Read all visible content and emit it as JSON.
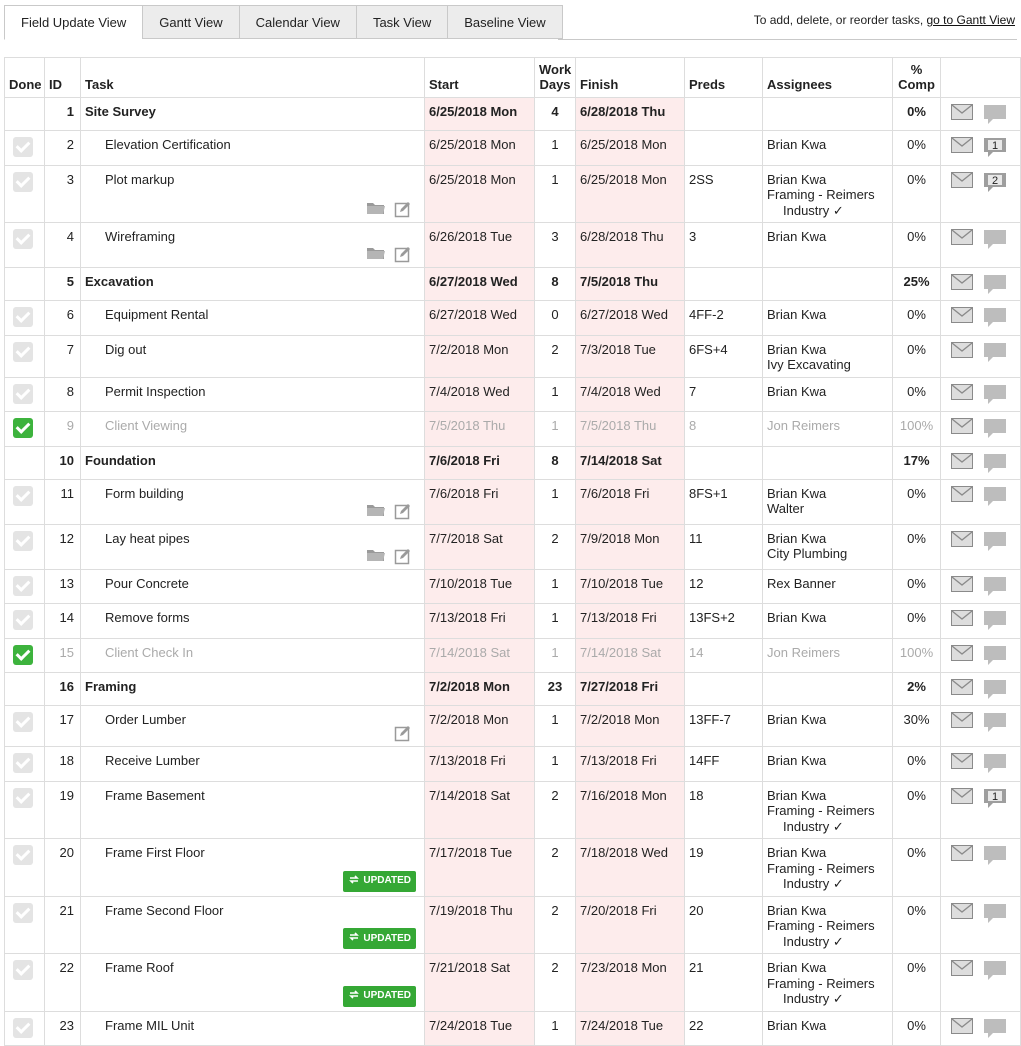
{
  "tabs": [
    "Field Update View",
    "Gantt View",
    "Calendar View",
    "Task View",
    "Baseline View"
  ],
  "hint": {
    "prefix": "To add, delete, or reorder tasks, ",
    "link": "go to Gantt View"
  },
  "columns": {
    "done": "Done",
    "id": "ID",
    "task": "Task",
    "start": "Start",
    "work_days": "Work Days",
    "finish": "Finish",
    "preds": "Preds",
    "assignees": "Assignees",
    "pct": "% Comp"
  },
  "rows": [
    {
      "id": "1",
      "task": "Site Survey",
      "start": "6/25/2018 Mon",
      "days": "4",
      "finish": "6/28/2018 Thu",
      "preds": "",
      "assignees": [],
      "pct": "0%",
      "summary": true
    },
    {
      "id": "2",
      "task": "Elevation Certification",
      "start": "6/25/2018 Mon",
      "days": "1",
      "finish": "6/25/2018 Mon",
      "preds": "",
      "assignees": [
        "Brian Kwa"
      ],
      "pct": "0%",
      "comments": "1"
    },
    {
      "id": "3",
      "task": "Plot markup",
      "start": "6/25/2018 Mon",
      "days": "1",
      "finish": "6/25/2018 Mon",
      "preds": "2SS",
      "assignees": [
        "Brian Kwa",
        "Framing - Reimers",
        "Industry ✓"
      ],
      "pct": "0%",
      "comments": "2",
      "files": true
    },
    {
      "id": "4",
      "task": "Wireframing",
      "start": "6/26/2018 Tue",
      "days": "3",
      "finish": "6/28/2018 Thu",
      "preds": "3",
      "assignees": [
        "Brian Kwa"
      ],
      "pct": "0%",
      "files": true
    },
    {
      "id": "5",
      "task": "Excavation",
      "start": "6/27/2018 Wed",
      "days": "8",
      "finish": "7/5/2018 Thu",
      "preds": "",
      "assignees": [],
      "pct": "25%",
      "summary": true
    },
    {
      "id": "6",
      "task": "Equipment Rental",
      "start": "6/27/2018 Wed",
      "days": "0",
      "finish": "6/27/2018 Wed",
      "preds": "4FF-2",
      "assignees": [
        "Brian Kwa"
      ],
      "pct": "0%"
    },
    {
      "id": "7",
      "task": "Dig out",
      "start": "7/2/2018 Mon",
      "days": "2",
      "finish": "7/3/2018 Tue",
      "preds": "6FS+4",
      "assignees": [
        "Brian Kwa",
        "Ivy Excavating"
      ],
      "pct": "0%"
    },
    {
      "id": "8",
      "task": "Permit Inspection",
      "start": "7/4/2018 Wed",
      "days": "1",
      "finish": "7/4/2018 Wed",
      "preds": "7",
      "assignees": [
        "Brian Kwa"
      ],
      "pct": "0%"
    },
    {
      "id": "9",
      "task": "Client Viewing",
      "start": "7/5/2018 Thu",
      "days": "1",
      "finish": "7/5/2018 Thu",
      "preds": "8",
      "assignees": [
        "Jon Reimers"
      ],
      "pct": "100%",
      "done": true
    },
    {
      "id": "10",
      "task": "Foundation",
      "start": "7/6/2018 Fri",
      "days": "8",
      "finish": "7/14/2018 Sat",
      "preds": "",
      "assignees": [],
      "pct": "17%",
      "summary": true
    },
    {
      "id": "11",
      "task": "Form building",
      "start": "7/6/2018 Fri",
      "days": "1",
      "finish": "7/6/2018 Fri",
      "preds": "8FS+1",
      "assignees": [
        "Brian Kwa",
        "Walter"
      ],
      "pct": "0%",
      "files": true
    },
    {
      "id": "12",
      "task": "Lay heat pipes",
      "start": "7/7/2018 Sat",
      "days": "2",
      "finish": "7/9/2018 Mon",
      "preds": "11",
      "assignees": [
        "Brian Kwa",
        "City Plumbing"
      ],
      "pct": "0%",
      "files": true
    },
    {
      "id": "13",
      "task": "Pour Concrete",
      "start": "7/10/2018 Tue",
      "days": "1",
      "finish": "7/10/2018 Tue",
      "preds": "12",
      "assignees": [
        "Rex Banner"
      ],
      "pct": "0%"
    },
    {
      "id": "14",
      "task": "Remove forms",
      "start": "7/13/2018 Fri",
      "days": "1",
      "finish": "7/13/2018 Fri",
      "preds": "13FS+2",
      "assignees": [
        "Brian Kwa"
      ],
      "pct": "0%"
    },
    {
      "id": "15",
      "task": "Client Check In",
      "start": "7/14/2018 Sat",
      "days": "1",
      "finish": "7/14/2018 Sat",
      "preds": "14",
      "assignees": [
        "Jon Reimers"
      ],
      "pct": "100%",
      "done": true
    },
    {
      "id": "16",
      "task": "Framing",
      "start": "7/2/2018 Mon",
      "days": "23",
      "finish": "7/27/2018 Fri",
      "preds": "",
      "assignees": [],
      "pct": "2%",
      "summary": true
    },
    {
      "id": "17",
      "task": "Order Lumber",
      "start": "7/2/2018 Mon",
      "days": "1",
      "finish": "7/2/2018 Mon",
      "preds": "13FF-7",
      "assignees": [
        "Brian Kwa"
      ],
      "pct": "30%",
      "edit_only": true
    },
    {
      "id": "18",
      "task": "Receive Lumber",
      "start": "7/13/2018 Fri",
      "days": "1",
      "finish": "7/13/2018 Fri",
      "preds": "14FF",
      "assignees": [
        "Brian Kwa"
      ],
      "pct": "0%"
    },
    {
      "id": "19",
      "task": "Frame Basement",
      "start": "7/14/2018 Sat",
      "days": "2",
      "finish": "7/16/2018 Mon",
      "preds": "18",
      "assignees": [
        "Brian Kwa",
        "Framing - Reimers",
        "Industry ✓"
      ],
      "pct": "0%",
      "comments": "1"
    },
    {
      "id": "20",
      "task": "Frame First Floor",
      "start": "7/17/2018 Tue",
      "days": "2",
      "finish": "7/18/2018 Wed",
      "preds": "19",
      "assignees": [
        "Brian Kwa",
        "Framing - Reimers",
        "Industry ✓"
      ],
      "pct": "0%",
      "updated": "UPDATED"
    },
    {
      "id": "21",
      "task": "Frame Second Floor",
      "start": "7/19/2018 Thu",
      "days": "2",
      "finish": "7/20/2018 Fri",
      "preds": "20",
      "assignees": [
        "Brian Kwa",
        "Framing - Reimers",
        "Industry ✓"
      ],
      "pct": "0%",
      "updated": "UPDATED"
    },
    {
      "id": "22",
      "task": "Frame Roof",
      "start": "7/21/2018 Sat",
      "days": "2",
      "finish": "7/23/2018 Mon",
      "preds": "21",
      "assignees": [
        "Brian Kwa",
        "Framing - Reimers",
        "Industry ✓"
      ],
      "pct": "0%",
      "updated": "UPDATED"
    },
    {
      "id": "23",
      "task": "Frame MIL Unit",
      "start": "7/24/2018 Tue",
      "days": "1",
      "finish": "7/24/2018 Tue",
      "preds": "22",
      "assignees": [
        "Brian Kwa"
      ],
      "pct": "0%"
    }
  ]
}
